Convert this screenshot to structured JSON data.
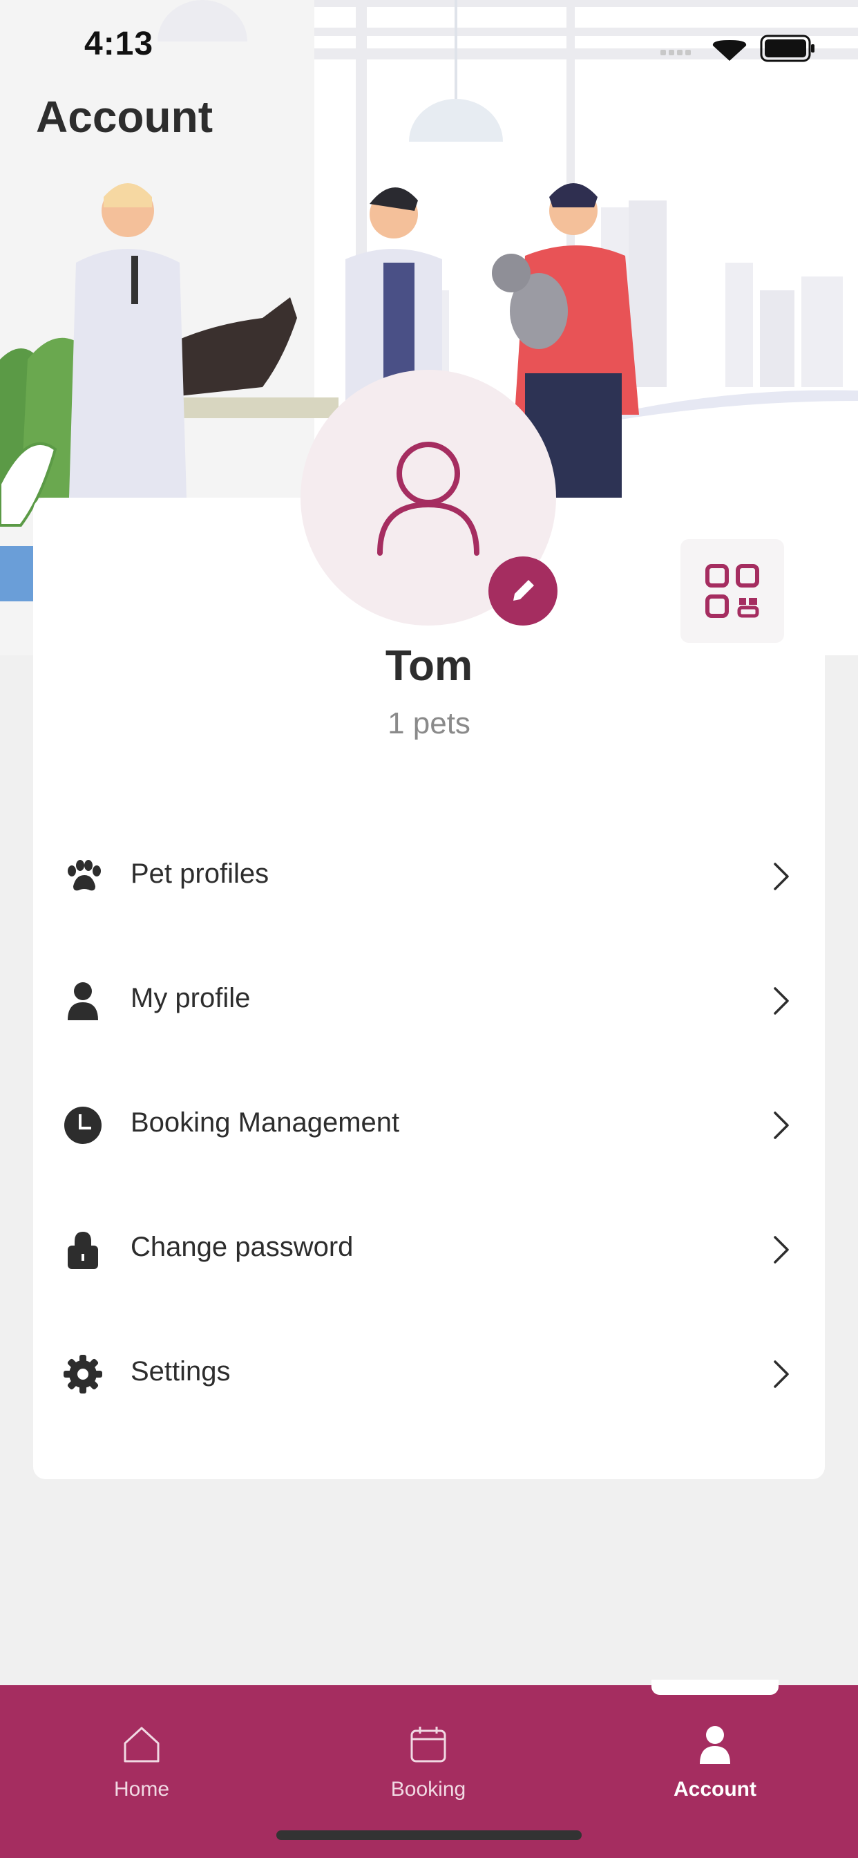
{
  "status_bar": {
    "time": "4:13"
  },
  "header": {
    "title": "Account"
  },
  "profile": {
    "name": "Tom",
    "pets_label": "1 pets"
  },
  "menu": [
    {
      "label": "Pet profiles",
      "icon": "paw-icon"
    },
    {
      "label": "My profile",
      "icon": "person-icon"
    },
    {
      "label": "Booking Management",
      "icon": "clock-icon"
    },
    {
      "label": "Change password",
      "icon": "lock-icon"
    },
    {
      "label": "Settings",
      "icon": "gear-icon"
    }
  ],
  "tabbar": {
    "tabs": [
      {
        "label": "Home",
        "icon": "home-icon",
        "active": false
      },
      {
        "label": "Booking",
        "icon": "calendar-icon",
        "active": false
      },
      {
        "label": "Account",
        "icon": "account-icon",
        "active": true
      }
    ]
  },
  "colors": {
    "brand": "#a52d60",
    "background": "#f0f0f0",
    "card": "#ffffff",
    "avatar_bg": "#f5ecef"
  }
}
